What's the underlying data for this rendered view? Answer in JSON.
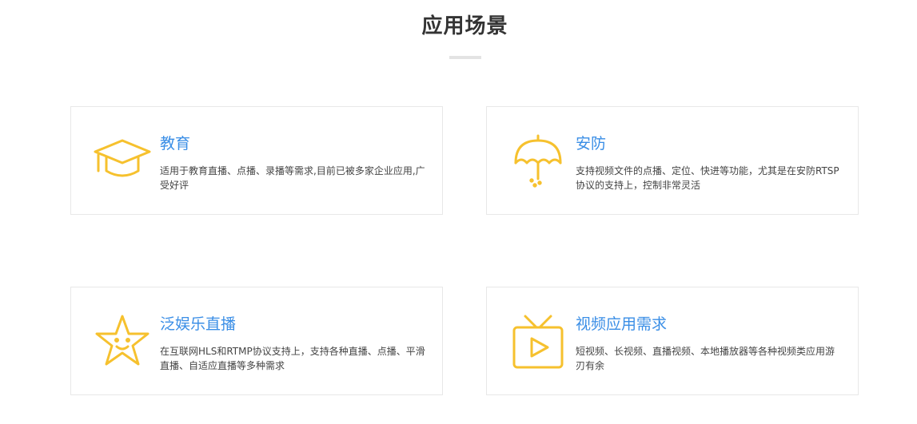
{
  "section": {
    "title": "应用场景"
  },
  "colors": {
    "accent": "#3a8ee6",
    "icon": "#f6c12e",
    "border": "#e8e8e8"
  },
  "cards": [
    {
      "title": "教育",
      "description": "适用于教育直播、点播、录播等需求,目前已被多家企业应用,广受好评",
      "icon": "graduation-cap-icon"
    },
    {
      "title": "安防",
      "description": "支持视频文件的点播、定位、快进等功能，尤其是在安防RTSP协议的支持上，控制非常灵活",
      "icon": "umbrella-icon"
    },
    {
      "title": "泛娱乐直播",
      "description": "在互联网HLS和RTMP协议支持上，支持各种直播、点播、平滑直播、自适应直播等多种需求",
      "icon": "star-smile-icon"
    },
    {
      "title": "视频应用需求",
      "description": "短视频、长视频、直播视频、本地播放器等各种视频类应用游刃有余",
      "icon": "tv-play-icon"
    }
  ]
}
